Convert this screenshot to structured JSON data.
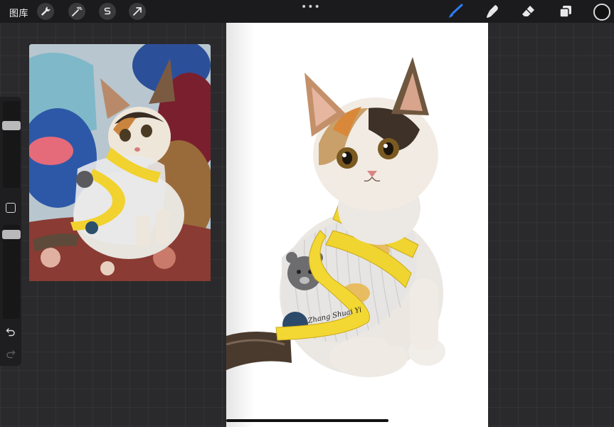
{
  "topbar": {
    "gallery_label": "图库",
    "tools_left": [
      "wrench-icon",
      "magic-wand-icon",
      "selection-s-icon",
      "transform-arrow-icon"
    ],
    "more_label": "•••",
    "tools_right": [
      "brush-icon",
      "smudge-icon",
      "eraser-icon",
      "layers-icon"
    ],
    "active_tool": "brush-icon",
    "active_color": "#2f7cf6",
    "current_color": "#111111"
  },
  "sidebar": {
    "brush_size_slider": "size",
    "opacity_slider": "opacity",
    "modify_button": "modify",
    "undo_icon": "undo-icon",
    "redo_icon": "redo-icon"
  },
  "canvas": {
    "signature_text": "Zhang Shuai Yi"
  }
}
